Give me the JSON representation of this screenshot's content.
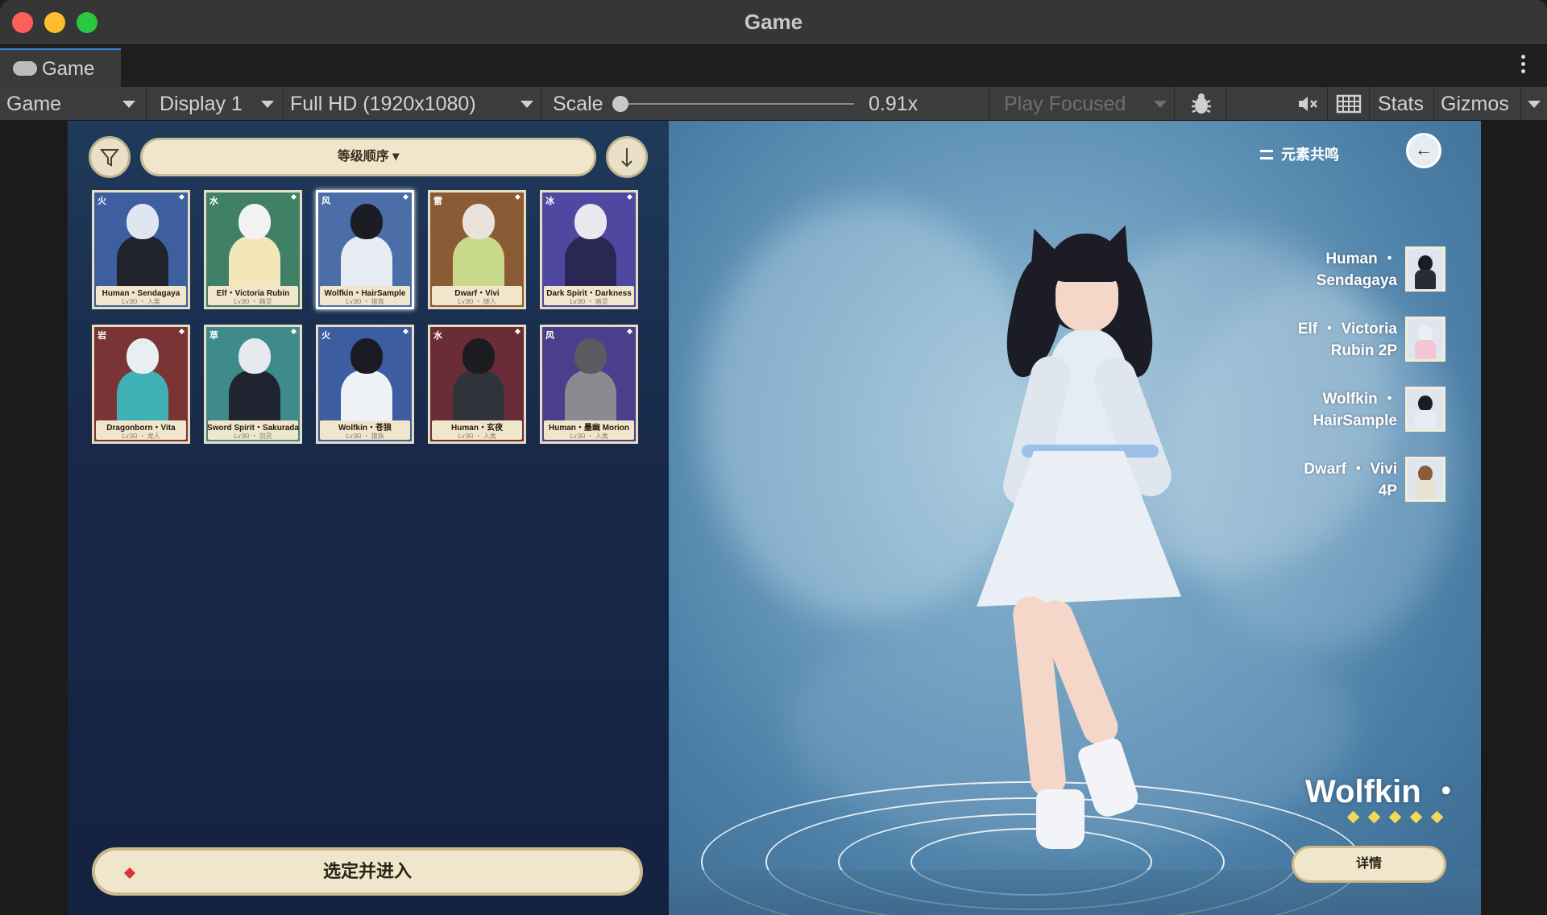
{
  "window": {
    "title": "Game"
  },
  "tab": {
    "label": "Game"
  },
  "toolbar": {
    "view_select": "Game",
    "display_select": "Display 1",
    "resolution_select": "Full HD (1920x1080)",
    "scale_label": "Scale",
    "scale_value": "0.91x",
    "play_mode": "Play Focused",
    "stats_label": "Stats",
    "gizmos_label": "Gizmos"
  },
  "left_panel": {
    "sort_label": "等级顺序 ▾",
    "cards": [
      {
        "element": "火",
        "name": "Human・Sendagaya",
        "lv": "Lv.90 ・ 人类",
        "bg": "#3d5fa0",
        "hair": "#dfe6f2",
        "outfit": "#20232c"
      },
      {
        "element": "水",
        "name": "Elf・Victoria Rubin",
        "lv": "Lv.90 ・ 精灵",
        "bg": "#3f8067",
        "hair": "#f2f2f5",
        "outfit": "#f3e7b9"
      },
      {
        "element": "风",
        "name": "Wolfkin・HairSample",
        "lv": "Lv.90 ・ 狼族",
        "bg": "#4b6ea8",
        "hair": "#1c1c24",
        "outfit": "#e6ecf2"
      },
      {
        "element": "雷",
        "name": "Dwarf・Vivi",
        "lv": "Lv.90 ・ 矮人",
        "bg": "#8a5b34",
        "hair": "#eae2dc",
        "outfit": "#c9d98a"
      },
      {
        "element": "冰",
        "name": "Dark Spirit・Darkness",
        "lv": "Lv.90 ・ 暗灵",
        "bg": "#5048a0",
        "hair": "#e8e8ee",
        "outfit": "#2a2752"
      },
      {
        "element": "岩",
        "name": "Dragonborn・Vita",
        "lv": "Lv.90 ・ 龙人",
        "bg": "#7a3436",
        "hair": "#e8eef2",
        "outfit": "#3fb1b5"
      },
      {
        "element": "草",
        "name": "Sword Spirit・Sakurada",
        "lv": "Lv.90 ・ 剑灵",
        "bg": "#3f8a8a",
        "hair": "#e6eaee",
        "outfit": "#1f2430"
      },
      {
        "element": "火",
        "name": "Wolfkin・苍狼",
        "lv": "Lv.90 ・ 狼族",
        "bg": "#3c5da0",
        "hair": "#1a1a22",
        "outfit": "#eef1f5"
      },
      {
        "element": "水",
        "name": "Human・玄夜",
        "lv": "Lv.90 ・ 人类",
        "bg": "#6a2d38",
        "hair": "#1b1b20",
        "outfit": "#30333a"
      },
      {
        "element": "风",
        "name": "Human・墨幽 Morion",
        "lv": "Lv.90 ・ 人类",
        "bg": "#4a3f8c",
        "hair": "#5a5a60",
        "outfit": "#8a8a90"
      }
    ],
    "enter_button": "选定并进入"
  },
  "right_panel": {
    "resonance_label": "元素共鸣",
    "back_icon": "←",
    "party": [
      {
        "name": "Human ・\nSendagaya",
        "hair": "#1c1c24",
        "outfit": "#2a2c34"
      },
      {
        "name": "Elf ・ Victoria\nRubin   2P",
        "hair": "#f0eef5",
        "outfit": "#f3c6d6"
      },
      {
        "name": "Wolfkin ・\nHairSample",
        "hair": "#1c1c24",
        "outfit": "#e6ecf2"
      },
      {
        "name": "Dwarf ・ Vivi\n4P",
        "hair": "#8a5b34",
        "outfit": "#e8e0d0"
      }
    ],
    "character_name": "Wolfkin ・",
    "stars": 5,
    "detail_button": "详情"
  },
  "colors": {
    "accent_tab": "#3d7de0",
    "cream": "#efe6cc",
    "star": "#f3d95a",
    "enter_dot": "#d93535"
  }
}
